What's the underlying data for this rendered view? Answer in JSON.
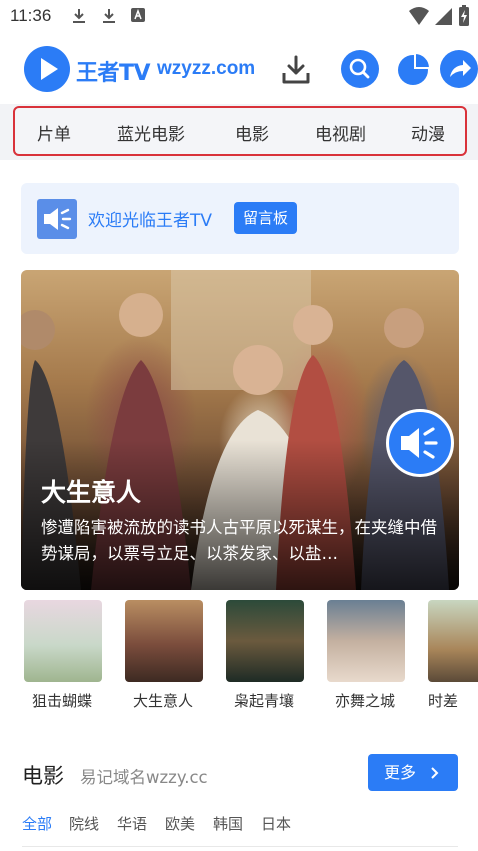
{
  "status_bar": {
    "time": "11:36",
    "left_icons": [
      "download-icon",
      "download-icon",
      "app-a-icon"
    ],
    "right_icons": [
      "wifi-icon",
      "signal-icon",
      "battery-charging-icon"
    ]
  },
  "header": {
    "logo_icon": "play-icon",
    "brand_name": "王者TV",
    "brand_domain": "wzyzz.com",
    "action_icons": [
      "download-icon",
      "search-icon",
      "pie-chart-icon",
      "share-icon"
    ],
    "accent": "#2b7cf6"
  },
  "nav": {
    "items": [
      "片单",
      "蓝光电影",
      "电影",
      "电视剧",
      "动漫"
    ],
    "highlight_border": "#d9323a"
  },
  "notice": {
    "icon": "speaker-icon",
    "text": "欢迎光临王者TV",
    "board_label": "留言板"
  },
  "banner": {
    "title": "大生意人",
    "description": "惨遭陷害被流放的读书人古平原以死谋生，在夹缝中借势谋局，以票号立足、以茶发家、以盐…",
    "fab_icon": "speaker-icon"
  },
  "posters": [
    {
      "title": "狙击蝴蝶"
    },
    {
      "title": "大生意人"
    },
    {
      "title": "枭起青壤"
    },
    {
      "title": "亦舞之城"
    },
    {
      "title": "时差"
    }
  ],
  "section": {
    "title": "电影",
    "subtitle": "易记域名wzzy.cc",
    "more_label": "更多",
    "more_icon": "chevron-right-icon",
    "filters": [
      "全部",
      "院线",
      "华语",
      "欧美",
      "韩国",
      "日本"
    ],
    "active_filter": "全部"
  }
}
